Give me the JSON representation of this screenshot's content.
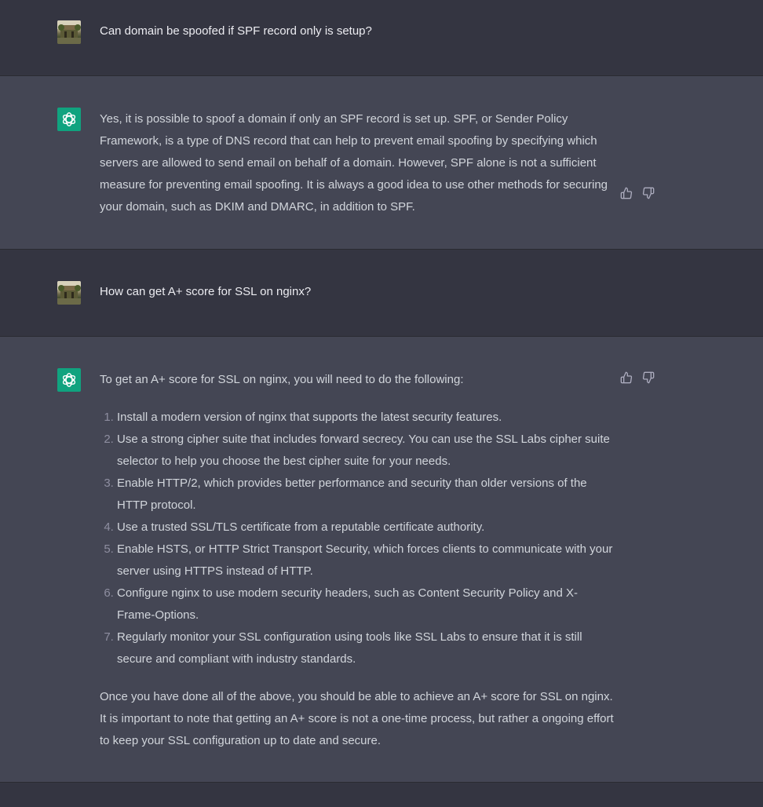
{
  "conversation": [
    {
      "role": "user",
      "text": "Can domain be spoofed if SPF record only is setup?"
    },
    {
      "role": "assistant",
      "paragraphs": [
        "Yes, it is possible to spoof a domain if only an SPF record is set up. SPF, or Sender Policy Framework, is a type of DNS record that can help to prevent email spoofing by specifying which servers are allowed to send email on behalf of a domain. However, SPF alone is not a sufficient measure for preventing email spoofing. It is always a good idea to use other methods for securing your domain, such as DKIM and DMARC, in addition to SPF."
      ]
    },
    {
      "role": "user",
      "text": "How can get A+ score for SSL on nginx?"
    },
    {
      "role": "assistant",
      "intro": "To get an A+ score for SSL on nginx, you will need to do the following:",
      "list": [
        "Install a modern version of nginx that supports the latest security features.",
        "Use a strong cipher suite that includes forward secrecy. You can use the SSL Labs cipher suite selector to help you choose the best cipher suite for your needs.",
        "Enable HTTP/2, which provides better performance and security than older versions of the HTTP protocol.",
        "Use a trusted SSL/TLS certificate from a reputable certificate authority.",
        "Enable HSTS, or HTTP Strict Transport Security, which forces clients to communicate with your server using HTTPS instead of HTTP.",
        "Configure nginx to use modern security headers, such as Content Security Policy and X-Frame-Options.",
        "Regularly monitor your SSL configuration using tools like SSL Labs to ensure that it is still secure and compliant with industry standards."
      ],
      "outro": "Once you have done all of the above, you should be able to achieve an A+ score for SSL on nginx. It is important to note that getting an A+ score is not a one-time process, but rather a ongoing effort to keep your SSL configuration up to date and secure."
    }
  ],
  "icons": {
    "bot_avatar": "openai-logo-icon",
    "user_avatar": "user-photo-avatar",
    "thumbs_up": "thumbs-up-icon",
    "thumbs_down": "thumbs-down-icon"
  },
  "colors": {
    "user_bg": "#343541",
    "assistant_bg": "#444654",
    "bot_avatar_bg": "#10a37f",
    "text": "#ececf1"
  }
}
